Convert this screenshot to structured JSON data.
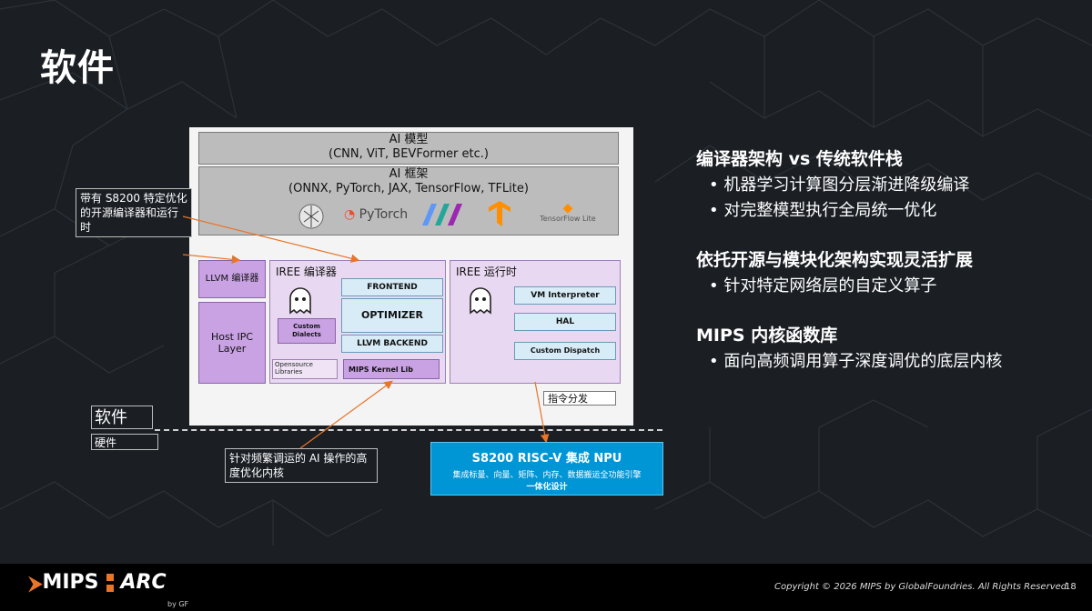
{
  "page": {
    "title": "软件"
  },
  "diagram": {
    "ai_model": {
      "title": "AI 模型",
      "subtitle": "(CNN, ViT, BEVFormer etc.)"
    },
    "ai_framework": {
      "title": "AI 框架",
      "subtitle": "(ONNX, PyTorch, JAX, TensorFlow, TFLite)",
      "logos": {
        "pytorch": "PyTorch",
        "tflite": "TensorFlow Lite"
      }
    },
    "llvm_compiler": "LLVM 编译器",
    "host_ipc": "Host IPC Layer",
    "iree_compiler": {
      "title": "IREE 编译器",
      "frontend": "FRONTEND",
      "optimizer": "OPTIMIZER",
      "llvm_backend": "LLVM BACKEND",
      "custom_dialects": "Custom Dialects",
      "opensource_libraries": "Opensource Libraries",
      "mips_kernel_lib": "MIPS Kernel Lib"
    },
    "iree_runtime": {
      "title": "IREE 运行时",
      "vm_interpreter": "VM Interpreter",
      "hal": "HAL",
      "custom_dispatch": "Custom Dispatch"
    },
    "instruction_dispatch": "指令分发",
    "software_label": "软件",
    "hardware_label": "硬件",
    "callout_compiler": "带有 S8200 特定优化的开源编译器和运行时",
    "callout_kernel": "针对频繁调运的 AI 操作的高度优化内核",
    "npu": {
      "title": "S8200 RISC-V 集成 NPU",
      "desc": "集成标量、向量、矩阵、内存、数据搬运全功能引擎",
      "desc2": "一体化设计"
    }
  },
  "right_panel": {
    "sections": [
      {
        "heading": "编译器架构 vs 传统软件栈",
        "bullets": [
          "机器学习计算图分层渐进降级编译",
          "对完整模型执行全局统一优化"
        ]
      },
      {
        "heading": "依托开源与模块化架构实现灵活扩展",
        "bullets": [
          "针对特定网络层的自定义算子"
        ]
      },
      {
        "heading": "MIPS 内核函数库",
        "bullets": [
          "面向高频调用算子深度调优的底层内核"
        ]
      }
    ]
  },
  "footer": {
    "logo_mips": "MIPS",
    "logo_arc": "ARC",
    "logo_by": "by GF",
    "copyright": "Copyright © 2026 MIPS by GlobalFoundries. All Rights Reserved.",
    "page_number": "18"
  },
  "colors": {
    "background": "#1b1f24",
    "npu": "#0096d6",
    "accent_orange": "#e8752a",
    "purple": "#c9a2e4"
  }
}
